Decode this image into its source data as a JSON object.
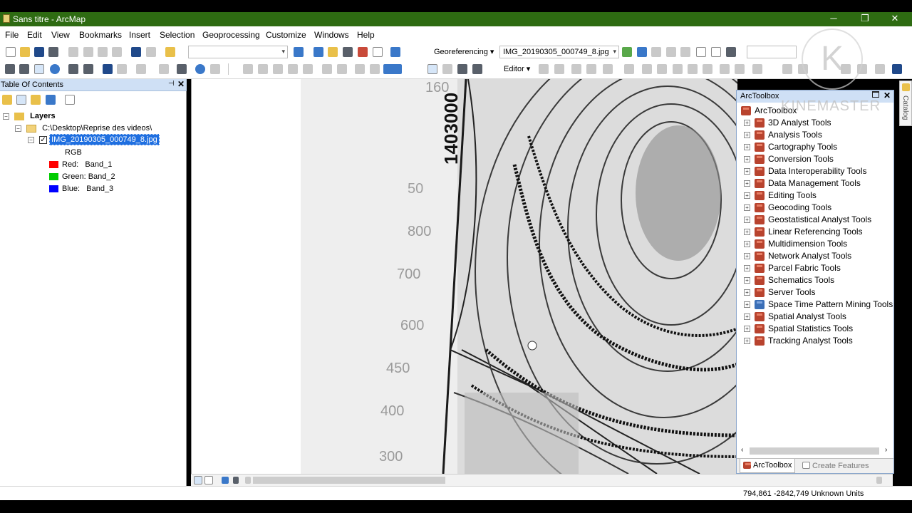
{
  "window": {
    "title": "Sans titre - ArcMap",
    "minimize": "─",
    "maximize": "❐",
    "close": "✕"
  },
  "menu": [
    "File",
    "Edit",
    "View",
    "Bookmarks",
    "Insert",
    "Selection",
    "Geoprocessing",
    "Customize",
    "Windows",
    "Help"
  ],
  "toolbar": {
    "georeferencing_label": "Georeferencing ▾",
    "layer_combo_value": "IMG_20190305_000749_8.jpg",
    "editor_label": "Editor ▾"
  },
  "toc": {
    "title": "Table Of Contents",
    "pin": "⊣",
    "close": "✕",
    "layers_label": "Layers",
    "folder_label": "C:\\Desktop\\Reprise des videos\\",
    "layer_name": "IMG_20190305_000749_8.jpg",
    "rgb_label": "RGB",
    "bands": [
      {
        "label": "Red:",
        "band": "Band_1",
        "color": "#ff0000"
      },
      {
        "label": "Green:",
        "band": "Band_2",
        "color": "#00cc00"
      },
      {
        "label": "Blue:",
        "band": "Band_3",
        "color": "#0000ff"
      }
    ]
  },
  "map": {
    "elevation_labels": [
      "160",
      "1403000",
      "50",
      "800",
      "700",
      "600",
      "450",
      "400",
      "300"
    ]
  },
  "arctoolbox": {
    "title": "ArcToolbox",
    "root": "ArcToolbox",
    "tools": [
      "3D Analyst Tools",
      "Analysis Tools",
      "Cartography Tools",
      "Conversion Tools",
      "Data Interoperability Tools",
      "Data Management Tools",
      "Editing Tools",
      "Geocoding Tools",
      "Geostatistical Analyst Tools",
      "Linear Referencing Tools",
      "Multidimension Tools",
      "Network Analyst Tools",
      "Parcel Fabric Tools",
      "Schematics Tools",
      "Server Tools",
      "Space Time Pattern Mining Tools",
      "Spatial Analyst Tools",
      "Spatial Statistics Tools",
      "Tracking Analyst Tools"
    ],
    "tabs": {
      "active": "ArcToolbox",
      "inactive": "Create Features"
    }
  },
  "catalog_tab": "Catalog",
  "watermark": {
    "letter": "K",
    "text": "KINEMASTER"
  },
  "status": {
    "coords": "794,861  -2842,749 Unknown Units"
  }
}
